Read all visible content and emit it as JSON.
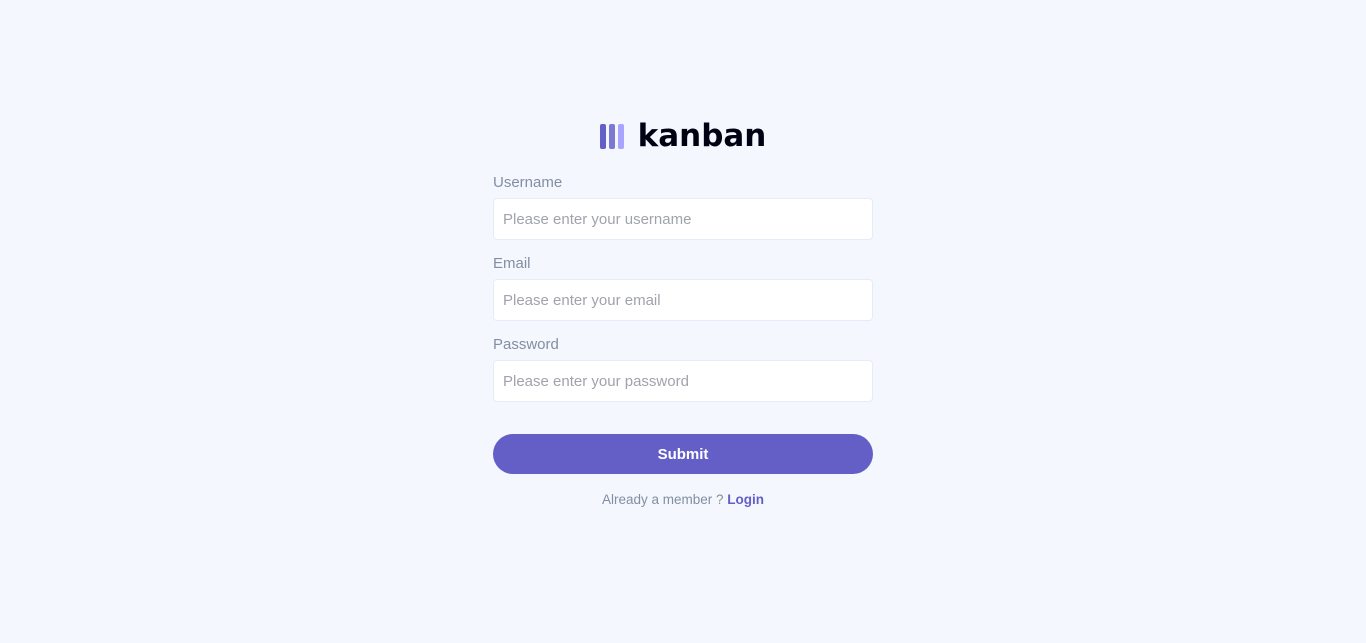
{
  "brand": {
    "name": "kanban",
    "logo_icon": "kanban-columns-icon",
    "logo_colors": [
      "#635fc7",
      "#7c79d2",
      "#a8a4ff"
    ]
  },
  "form": {
    "username": {
      "label": "Username",
      "placeholder": "Please enter your username",
      "value": ""
    },
    "email": {
      "label": "Email",
      "placeholder": "Please enter your email",
      "value": ""
    },
    "password": {
      "label": "Password",
      "placeholder": "Please enter your password",
      "value": ""
    },
    "submit_label": "Submit"
  },
  "footer": {
    "prompt": "Already a member ?",
    "link_label": "Login"
  },
  "colors": {
    "accent": "#635fc7",
    "background": "#f4f7fd",
    "muted_text": "#828fa3",
    "heading_text": "#000112"
  }
}
